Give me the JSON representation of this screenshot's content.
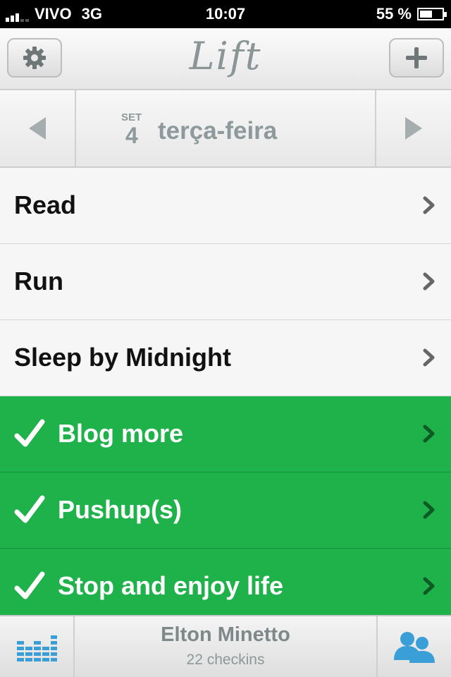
{
  "status_bar": {
    "carrier": "VIVO",
    "network": "3G",
    "time": "10:07",
    "battery": "55 %",
    "battery_level": 0.55,
    "signal_bars": 3
  },
  "nav": {
    "logo": "Lift",
    "settings_icon": "gear-icon",
    "add_icon": "plus-icon"
  },
  "date": {
    "month": "SET",
    "day": "4",
    "weekday": "terça-feira",
    "prev_icon": "triangle-left-icon",
    "next_icon": "triangle-right-icon"
  },
  "habits": [
    {
      "label": "Read",
      "done": false
    },
    {
      "label": "Run",
      "done": false
    },
    {
      "label": "Sleep by Midnight",
      "done": false
    },
    {
      "label": "Blog more",
      "done": true
    },
    {
      "label": "Pushup(s)",
      "done": true
    },
    {
      "label": "Stop and enjoy life",
      "done": true
    }
  ],
  "colors": {
    "done_green": "#1fb14a",
    "accent_blue": "#3a9fd6",
    "muted_gray": "#8e999b"
  },
  "footer": {
    "user_name": "Elton Minetto",
    "checkins": "22 checkins",
    "stats_icon": "bar-chart-icon",
    "friends_icon": "people-icon"
  }
}
